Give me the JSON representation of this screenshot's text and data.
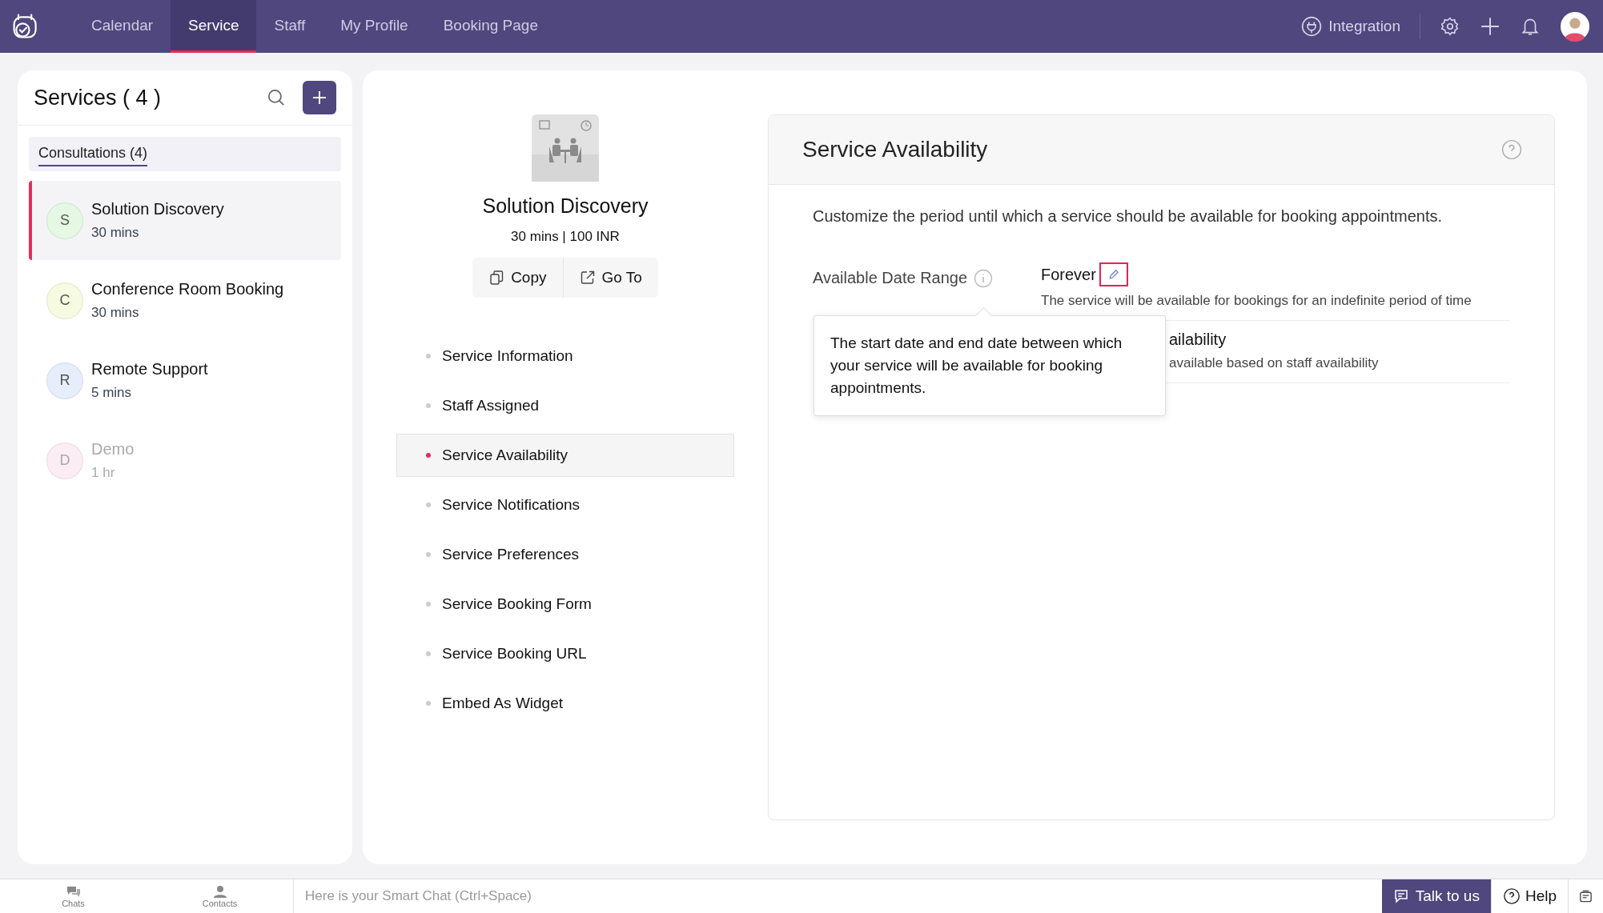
{
  "top_bar": {
    "nav_tabs": [
      {
        "label": "Calendar",
        "selected": false
      },
      {
        "label": "Service",
        "selected": true
      },
      {
        "label": "Staff",
        "selected": false
      },
      {
        "label": "My Profile",
        "selected": false
      },
      {
        "label": "Booking Page",
        "selected": false
      }
    ],
    "integration": "Integration"
  },
  "services_panel": {
    "title": "Services ( 4 )",
    "category_tab": {
      "label": "Consultations (4)",
      "selected": true
    },
    "items": [
      {
        "initial": "S",
        "name": "Solution Discovery",
        "duration": "30 mins",
        "color": "#e5f8e3",
        "selected": true,
        "disabled": false
      },
      {
        "initial": "C",
        "name": "Conference Room Booking",
        "duration": "30 mins",
        "color": "#f6fae0",
        "selected": false,
        "disabled": false
      },
      {
        "initial": "R",
        "name": "Remote Support",
        "duration": "5 mins",
        "color": "#e6edfb",
        "selected": false,
        "disabled": false
      },
      {
        "initial": "D",
        "name": "Demo",
        "duration": "1 hr",
        "color": "#fcedf4",
        "selected": false,
        "disabled": true
      }
    ]
  },
  "service_detail": {
    "name": "Solution Discovery",
    "meta": "30 mins | 100 INR",
    "actions": [
      {
        "kind": "copy",
        "label": "Copy"
      },
      {
        "kind": "goto",
        "label": "Go To"
      }
    ],
    "sections": [
      {
        "label": "Service Information",
        "selected": false
      },
      {
        "label": "Staff Assigned",
        "selected": false
      },
      {
        "label": "Service Availability",
        "selected": true
      },
      {
        "label": "Service Notifications",
        "selected": false
      },
      {
        "label": "Service Preferences",
        "selected": false
      },
      {
        "label": "Service Booking Form",
        "selected": false
      },
      {
        "label": "Service Booking URL",
        "selected": false
      },
      {
        "label": "Embed As Widget",
        "selected": false
      }
    ]
  },
  "availability": {
    "title": "Service Availability",
    "description": "Customize the period until which a service should be available for booking appointments.",
    "field_label": "Available Date Range",
    "options": [
      {
        "title": "Forever",
        "description": "The service will be available for bookings for an indefinite period of time",
        "editable": true,
        "covered": false
      },
      {
        "title": "ailability",
        "description": "available based on staff availability",
        "editable": false,
        "covered": true
      }
    ],
    "tooltip": "The start date and end date between which your service will be available for booking appointments."
  },
  "bottom_bar": {
    "tabs": [
      {
        "kind": "chats",
        "label": "Chats"
      },
      {
        "kind": "contacts",
        "label": "Contacts"
      }
    ],
    "chat_placeholder": "Here is your Smart Chat (Ctrl+Space)",
    "talk_button": "Talk to us",
    "help_button": "Help"
  }
}
